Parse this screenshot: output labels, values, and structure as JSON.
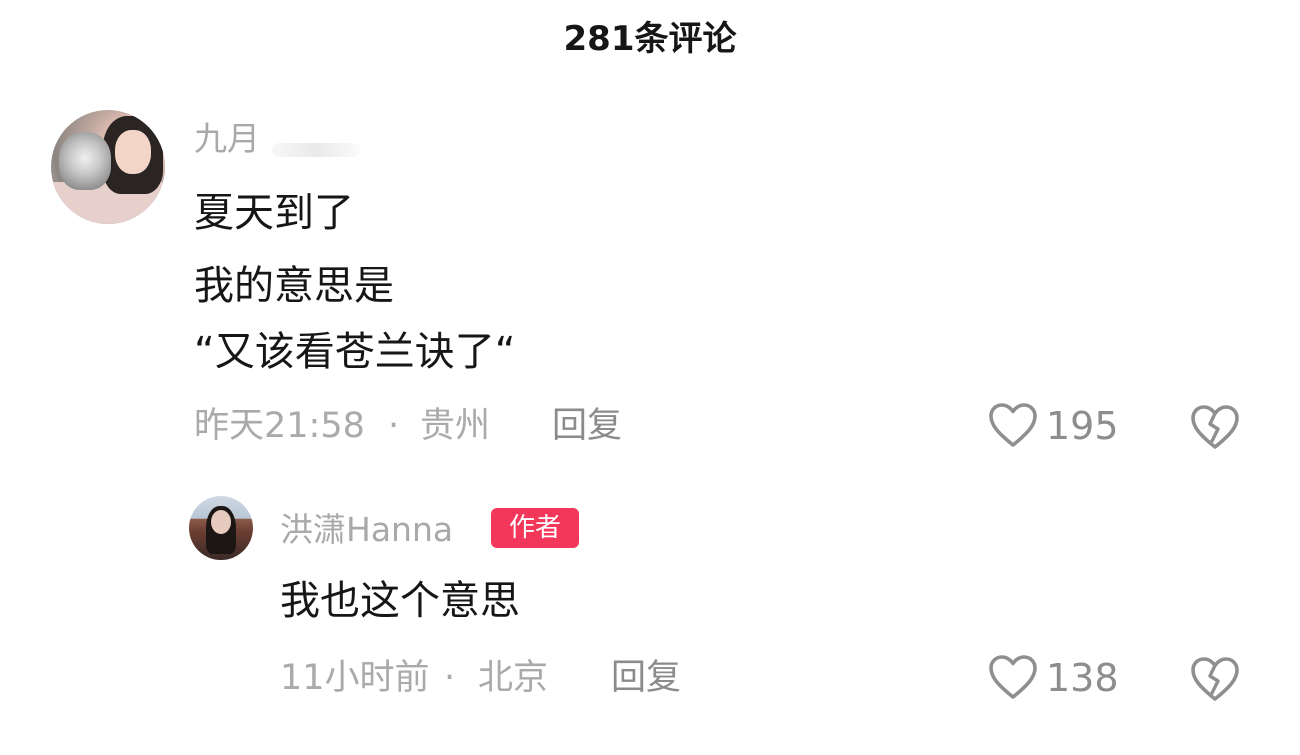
{
  "header": {
    "title": "281条评论"
  },
  "comments": [
    {
      "username": "九月",
      "lines": [
        "夏天到了",
        "我的意思是",
        "“又该看苍兰诀了“"
      ],
      "time": "昨天21:58",
      "location": "贵州",
      "meta_separator": "·",
      "reply_label": "回复",
      "likes": "195",
      "icons": {
        "like": "heart-outline-icon",
        "dislike": "broken-heart-icon"
      },
      "reply": {
        "username": "洪潇Hanna",
        "badge": "作者",
        "text": "我也这个意思",
        "time": "11小时前",
        "location": "北京",
        "meta_separator": "·",
        "reply_label": "回复",
        "likes": "138",
        "badge_color": "#f2375a",
        "icons": {
          "like": "heart-outline-icon",
          "dislike": "broken-heart-icon"
        }
      }
    }
  ]
}
